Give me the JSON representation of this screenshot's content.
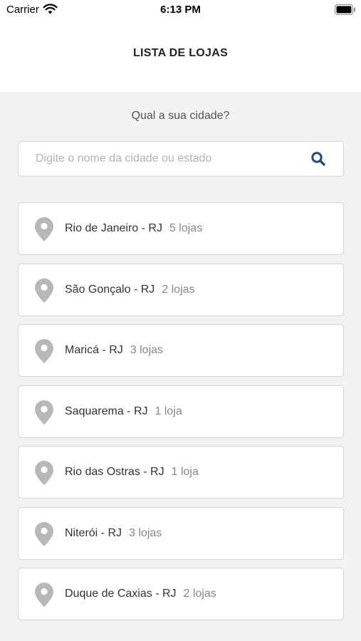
{
  "status_bar": {
    "carrier": "Carrier",
    "time": "6:13 PM"
  },
  "header": {
    "title": "LISTA DE LOJAS"
  },
  "prompt": "Qual a sua cidade?",
  "search": {
    "placeholder": "Digite o nome da cidade ou estado",
    "value": ""
  },
  "cities": [
    {
      "name": "Rio de Janeiro - RJ",
      "count": "5 lojas"
    },
    {
      "name": "São Gonçalo - RJ",
      "count": "2 lojas"
    },
    {
      "name": "Maricá - RJ",
      "count": "3 lojas"
    },
    {
      "name": "Saquarema - RJ",
      "count": "1 loja"
    },
    {
      "name": "Rio das Ostras - RJ",
      "count": "1 loja"
    },
    {
      "name": "Niterói - RJ",
      "count": "3 lojas"
    },
    {
      "name": "Duque de Caxias - RJ",
      "count": "2 lojas"
    }
  ],
  "icons": {
    "row": "map-pin-icon",
    "search": "search-icon"
  },
  "colors": {
    "accent": "#1f4b7a",
    "pin": "#b8b8b8",
    "background": "#f2f2f2"
  }
}
